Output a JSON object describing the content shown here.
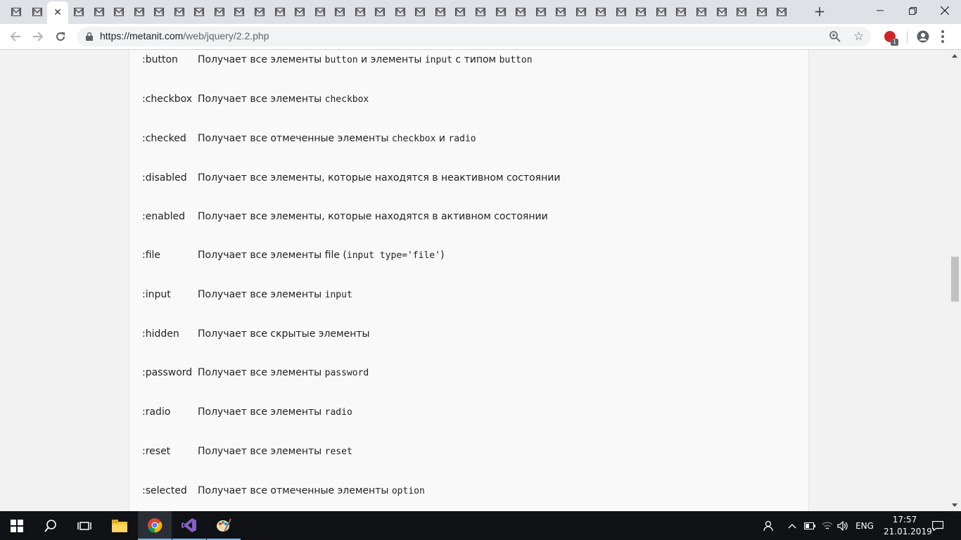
{
  "browser": {
    "tab_count": 39,
    "active_tab_index": 2,
    "url_host": "https://metanit.com",
    "url_path": "/web/jquery/2.2.php",
    "adblock_badge": "1",
    "adblock_label": "ABP"
  },
  "selectors": [
    {
      "name": ":button",
      "parts": [
        {
          "t": "Получает все элементы "
        },
        {
          "c": "button"
        },
        {
          "t": " и элементы "
        },
        {
          "c": "input"
        },
        {
          "t": " с типом "
        },
        {
          "c": "button"
        }
      ]
    },
    {
      "name": ":checkbox",
      "parts": [
        {
          "t": "Получает все элементы "
        },
        {
          "c": "checkbox"
        }
      ]
    },
    {
      "name": ":checked",
      "parts": [
        {
          "t": "Получает все отмеченные элементы "
        },
        {
          "c": "checkbox"
        },
        {
          "t": " и "
        },
        {
          "c": "radio"
        }
      ]
    },
    {
      "name": ":disabled",
      "parts": [
        {
          "t": "Получает все элементы, которые находятся в неактивном состоянии"
        }
      ]
    },
    {
      "name": ":enabled",
      "parts": [
        {
          "t": "Получает все элементы, которые находятся в активном состоянии"
        }
      ]
    },
    {
      "name": ":file",
      "parts": [
        {
          "t": "Получает все элементы file ("
        },
        {
          "c": "input type='file'"
        },
        {
          "t": ")"
        }
      ]
    },
    {
      "name": ":input",
      "parts": [
        {
          "t": "Получает все элементы "
        },
        {
          "c": "input"
        }
      ]
    },
    {
      "name": ":hidden",
      "parts": [
        {
          "t": "Получает все скрытые элементы"
        }
      ]
    },
    {
      "name": ":password",
      "parts": [
        {
          "t": "Получает все элементы "
        },
        {
          "c": "password"
        }
      ]
    },
    {
      "name": ":radio",
      "parts": [
        {
          "t": "Получает все элементы "
        },
        {
          "c": "radio"
        }
      ]
    },
    {
      "name": ":reset",
      "parts": [
        {
          "t": "Получает все элементы "
        },
        {
          "c": "reset"
        }
      ]
    },
    {
      "name": ":selected",
      "parts": [
        {
          "t": "Получает все отмеченные элементы "
        },
        {
          "c": "option"
        }
      ]
    }
  ],
  "taskbar": {
    "language": "ENG",
    "time": "17:57",
    "date": "21.01.2019"
  },
  "colors": {
    "taskbar_bg": "#101216",
    "tabstrip_bg": "#dee1e6",
    "active_indicator": "#76b9ed"
  }
}
